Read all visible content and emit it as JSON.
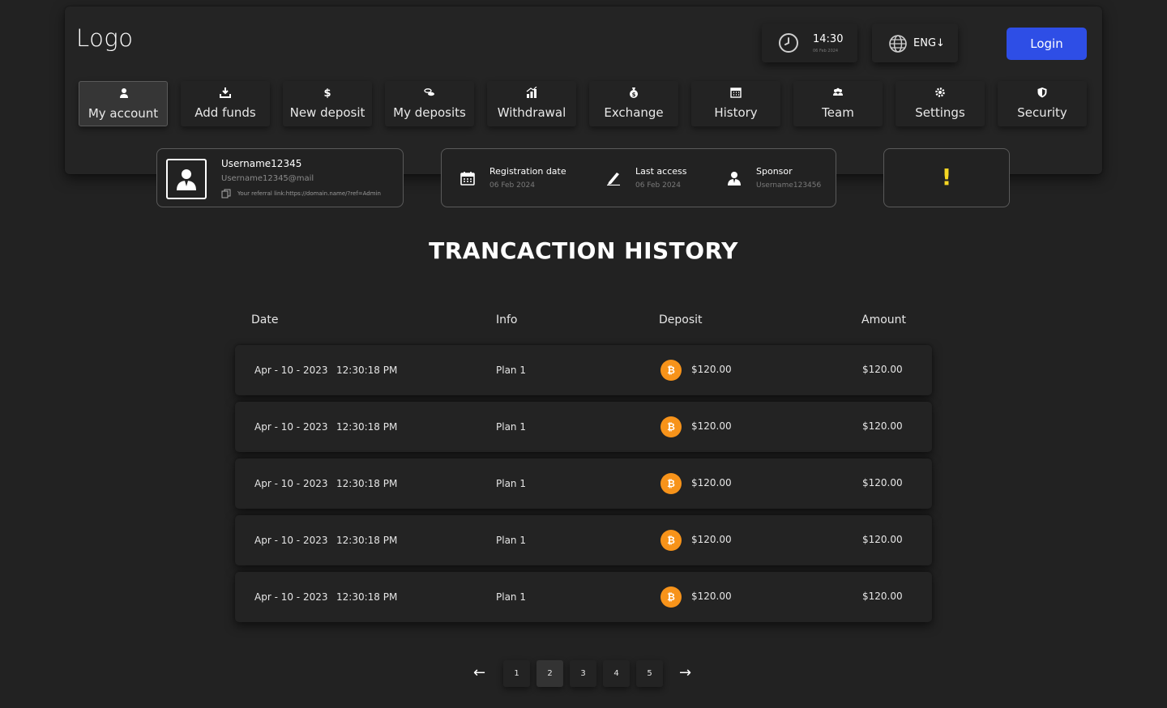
{
  "header": {
    "logo": "Logo",
    "clock": {
      "icon": "clock-icon",
      "time": "14:30",
      "date": "06 Feb 2024"
    },
    "language": {
      "icon": "globe-icon",
      "label": "ENG↓"
    },
    "login_label": "Login",
    "login_color": "#2e4ee6"
  },
  "nav": {
    "items": [
      {
        "label": "My account",
        "icon": "user-icon",
        "active": true
      },
      {
        "label": "Add funds",
        "icon": "download-icon"
      },
      {
        "label": "New deposit",
        "icon": "dollar-icon"
      },
      {
        "label": "My deposits",
        "icon": "coins-icon"
      },
      {
        "label": "Withdrawal",
        "icon": "chart-up-icon"
      },
      {
        "label": "Exchange",
        "icon": "money-bag-icon"
      },
      {
        "label": "History",
        "icon": "calendar-icon"
      },
      {
        "label": "Team",
        "icon": "team-icon"
      },
      {
        "label": "Settings",
        "icon": "gear-icon"
      },
      {
        "label": "Security",
        "icon": "shield-icon"
      }
    ]
  },
  "user": {
    "username": "Username12345",
    "email": "Username12345@mail",
    "referral": "Your referral link:https://domain.name/?ref=Admin"
  },
  "info": {
    "registration": {
      "title": "Registration date",
      "value": "06 Feb 2024"
    },
    "last_access": {
      "title": "Last access",
      "value": "06 Feb 2024"
    },
    "sponsor": {
      "title": "Sponsor",
      "value": "Username123456"
    }
  },
  "alert": {
    "mark": "!",
    "color": "#f5d623"
  },
  "title": "TRANCACTION HISTORY",
  "table": {
    "columns": [
      "Date",
      "Info",
      "Deposit",
      "Amount"
    ],
    "rows": [
      {
        "date": "Apr - 10 - 2023",
        "time": "12:30:18 PM",
        "info": "Plan 1",
        "coin": "₿",
        "deposit": "$120.00",
        "amount": "$120.00"
      },
      {
        "date": "Apr - 10 - 2023",
        "time": "12:30:18 PM",
        "info": "Plan 1",
        "coin": "₿",
        "deposit": "$120.00",
        "amount": "$120.00"
      },
      {
        "date": "Apr - 10 - 2023",
        "time": "12:30:18 PM",
        "info": "Plan 1",
        "coin": "₿",
        "deposit": "$120.00",
        "amount": "$120.00"
      },
      {
        "date": "Apr - 10 - 2023",
        "time": "12:30:18 PM",
        "info": "Plan 1",
        "coin": "₿",
        "deposit": "$120.00",
        "amount": "$120.00"
      },
      {
        "date": "Apr - 10 - 2023",
        "time": "12:30:18 PM",
        "info": "Plan 1",
        "coin": "₿",
        "deposit": "$120.00",
        "amount": "$120.00"
      }
    ]
  },
  "pagination": {
    "prev": "←",
    "next": "→",
    "pages": [
      "1",
      "2",
      "3",
      "4",
      "5"
    ],
    "current": "2"
  }
}
